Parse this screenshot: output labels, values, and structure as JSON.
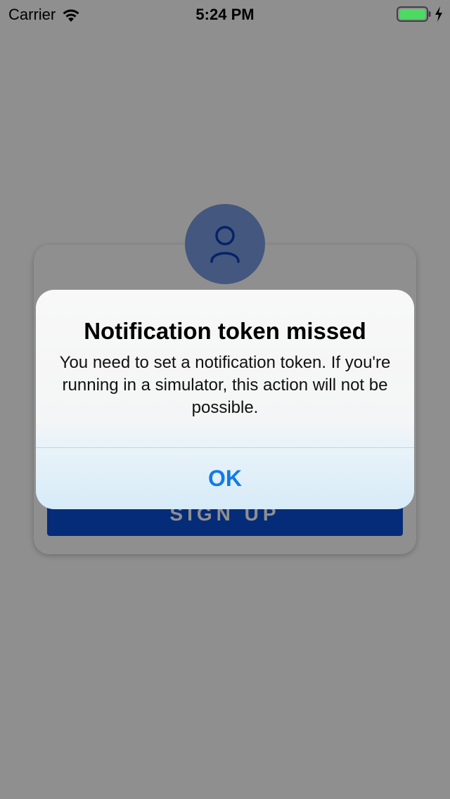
{
  "status_bar": {
    "carrier": "Carrier",
    "time": "5:24 PM",
    "wifi_icon": "wifi-icon",
    "battery_icon": "battery-icon",
    "charging_icon": "bolt-icon",
    "battery_color": "#4cd964"
  },
  "background": {
    "avatar_icon": "person-icon",
    "button_label": "SIGN UP",
    "accent_color": "#0a4fd6"
  },
  "alert": {
    "title": "Notification token missed",
    "message": "You need to set a notification token. If you're running in a simulator, this action will not be possible.",
    "ok_label": "OK",
    "ok_color": "#127ae8"
  }
}
